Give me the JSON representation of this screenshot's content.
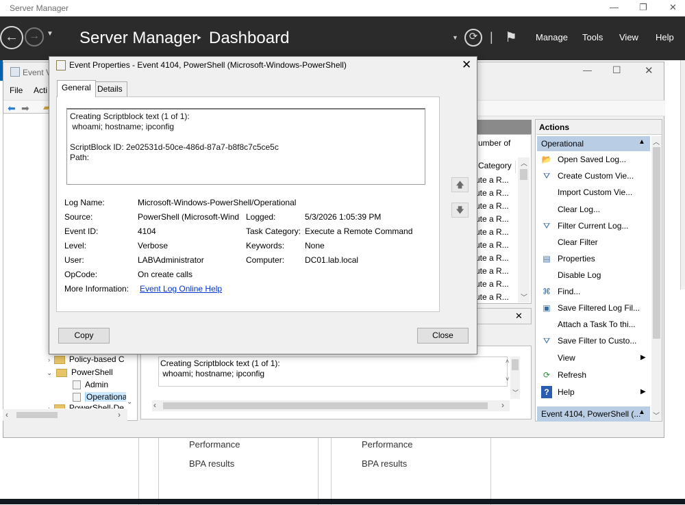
{
  "server_manager": {
    "window_title": "Server Manager",
    "breadcrumb": "Server Manager",
    "separator": "‣",
    "page": "Dashboard",
    "menu": [
      "Manage",
      "Tools",
      "View",
      "Help"
    ],
    "tiles": [
      {
        "performance": "Performance",
        "bpa": "BPA results"
      },
      {
        "performance": "Performance",
        "bpa": "BPA results"
      }
    ]
  },
  "event_viewer": {
    "title": "Event V",
    "menu": [
      "File",
      "Acti"
    ],
    "grid_header_partial": "umber of",
    "category_header": "Category",
    "category_items": [
      "ute a R...",
      "ute a R...",
      "ute a R...",
      "ute a R...",
      "ute a R...",
      "ute a R...",
      "ute a R...",
      "ute a R...",
      "ute a R...",
      "ute a R..."
    ],
    "tree": {
      "policy_based": "Policy-based C",
      "powershell": "PowerShell",
      "admin": "Admin",
      "operational": "Operational",
      "powershell_de": "PowerShell-De"
    },
    "preview_text": "Creating Scriptblock text (1 of 1):\n whoami; hostname; ipconfig",
    "actions": {
      "header": "Actions",
      "section": "Operational",
      "items": [
        {
          "label": "Open Saved Log...",
          "icon": "folder-open-icon"
        },
        {
          "label": "Create Custom Vie...",
          "icon": "filter-create-icon"
        },
        {
          "label": "Import Custom Vie...",
          "icon": ""
        },
        {
          "label": "Clear Log...",
          "icon": ""
        },
        {
          "label": "Filter Current Log...",
          "icon": "filter-icon"
        },
        {
          "label": "Clear Filter",
          "icon": ""
        },
        {
          "label": "Properties",
          "icon": "properties-icon"
        },
        {
          "label": "Disable Log",
          "icon": ""
        },
        {
          "label": "Find...",
          "icon": "binoculars-icon"
        },
        {
          "label": "Save Filtered Log Fil...",
          "icon": "save-icon"
        },
        {
          "label": "Attach a Task To thi...",
          "icon": ""
        },
        {
          "label": "Save Filter to Custo...",
          "icon": "filter-save-icon"
        },
        {
          "label": "View",
          "icon": ""
        },
        {
          "label": "Refresh",
          "icon": "refresh-icon"
        },
        {
          "label": "Help",
          "icon": "help-icon"
        }
      ],
      "event_section": "Event 4104, PowerShell (..."
    }
  },
  "dialog": {
    "title": "Event Properties - Event 4104, PowerShell (Microsoft-Windows-PowerShell)",
    "tabs": [
      "General",
      "Details"
    ],
    "text": "Creating Scriptblock text (1 of 1):\n whoami; hostname; ipconfig\n\nScriptBlock ID: 2e02531d-50ce-486d-87a7-b8f8c7c5ce5c\nPath:",
    "fields": {
      "log_name_label": "Log Name:",
      "log_name": "Microsoft-Windows-PowerShell/Operational",
      "source_label": "Source:",
      "source": "PowerShell (Microsoft-Wind",
      "logged_label": "Logged:",
      "logged": "5/3/2026 1:05:39 PM",
      "event_id_label": "Event ID:",
      "event_id": "4104",
      "task_category_label": "Task Category:",
      "task_category": "Execute a Remote Command",
      "level_label": "Level:",
      "level": "Verbose",
      "keywords_label": "Keywords:",
      "keywords": "None",
      "user_label": "User:",
      "user": "LAB\\Administrator",
      "computer_label": "Computer:",
      "computer": "DC01.lab.local",
      "opcode_label": "OpCode:",
      "opcode": "On create calls",
      "more_info_label": "More Information:",
      "more_info_link": "Event Log Online Help"
    },
    "copy_button": "Copy",
    "close_button": "Close"
  }
}
